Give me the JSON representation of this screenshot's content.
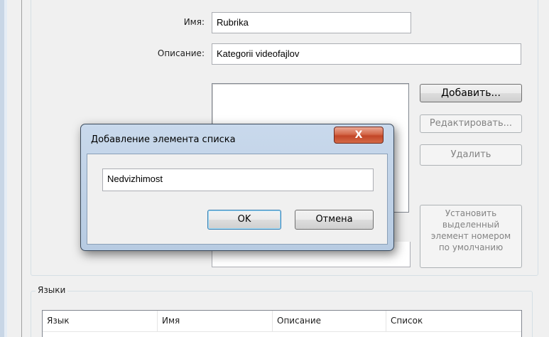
{
  "form": {
    "name_label": "Имя:",
    "name_value": "Rubrika",
    "description_label": "Описание:",
    "description_value": "Kategorii videofajlov"
  },
  "list_buttons": {
    "add": "Добавить...",
    "edit": "Редактировать...",
    "delete": "Удалить",
    "set_default": [
      "Установить",
      "выделенный",
      "элемент номером",
      "по умолчанию"
    ]
  },
  "languages": {
    "group_title": "Языки",
    "columns": [
      "Язык",
      "Имя",
      "Описание",
      "Список"
    ]
  },
  "dialog": {
    "title": "Добавление элемента списка",
    "close_glyph": "X",
    "input_value": "Nedvizhimost",
    "ok_label": "OK",
    "cancel_label": "Отмена"
  }
}
